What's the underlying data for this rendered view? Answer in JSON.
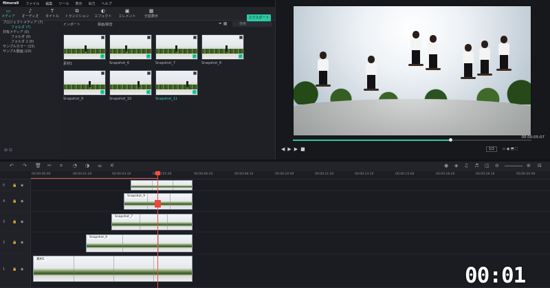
{
  "app": {
    "name": "filmora9"
  },
  "menu": [
    "ファイル",
    "編集",
    "ツール",
    "表示",
    "出力",
    "ヘルプ"
  ],
  "toolbar": {
    "tabs": [
      {
        "label": "メディア",
        "icon": "folder-icon"
      },
      {
        "label": "オーディオ",
        "icon": "music-icon"
      },
      {
        "label": "タイトル",
        "icon": "title-icon"
      },
      {
        "label": "トランジション",
        "icon": "transition-icon"
      },
      {
        "label": "エフェクト",
        "icon": "effects-icon"
      },
      {
        "label": "エレメント",
        "icon": "elements-icon"
      },
      {
        "label": "分割表示",
        "icon": "split-screen-icon"
      }
    ],
    "export_label": "エクスポート"
  },
  "sidebar": {
    "items": [
      {
        "label": "プロジェクトメディア (7)"
      },
      {
        "label": "フォルダ (7)"
      },
      {
        "label": "共有メディア (0)"
      },
      {
        "label": "フォルダ (0)"
      },
      {
        "label": "フォルダ 2 (0)"
      },
      {
        "label": "サンプルカラー (15)"
      },
      {
        "label": "サンプル動画 (20)"
      }
    ]
  },
  "media": {
    "import_label": "インポート",
    "record_label": "録画/録音",
    "search_placeholder": "検索",
    "items": [
      {
        "label": "素材1"
      },
      {
        "label": "Snapshot_6"
      },
      {
        "label": "Snapshot_7"
      },
      {
        "label": "Snapshot_8"
      },
      {
        "label": "Snapshot_9"
      },
      {
        "label": "Snapshot_10"
      },
      {
        "label": "Snapshot_11"
      }
    ]
  },
  "preview": {
    "timecode": "00:00:05:07",
    "ratio": "1/2",
    "progress": 0.66
  },
  "ruler": {
    "ticks": [
      "00:00:00:00",
      "00:00:01:20",
      "00:00:03:10",
      "00:00:05:00",
      "00:00:06:20",
      "00:00:08:10",
      "00:00:10:00",
      "00:00:11:20",
      "00:00:13:10",
      "00:00:15:00",
      "00:00:16:20",
      "00:00:18:10",
      "00:00:20:00"
    ]
  },
  "tracks": [
    {
      "label": "5",
      "clip": ""
    },
    {
      "label": "4",
      "clip": "Snapshot_9"
    },
    {
      "label": "3",
      "clip": "Snapshot_7"
    },
    {
      "label": "2",
      "clip": "Snapshot_6"
    },
    {
      "label": "1",
      "clip": "素材1"
    }
  ],
  "overlay": {
    "timer": "00:01"
  }
}
